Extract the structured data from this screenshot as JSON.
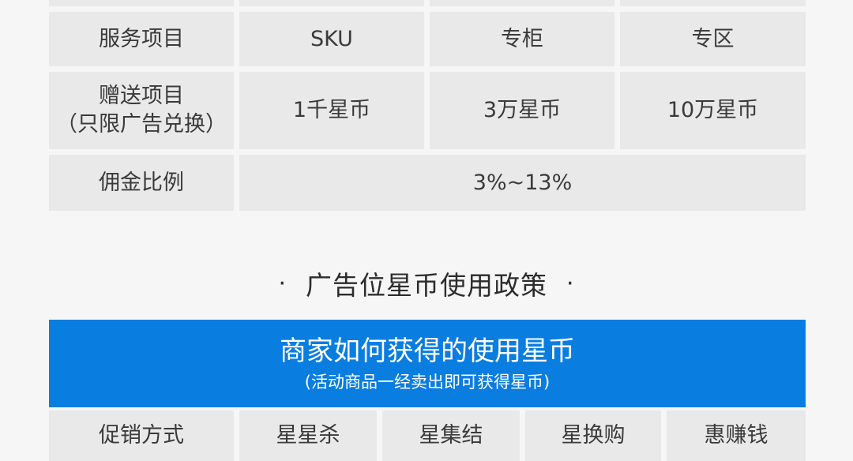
{
  "table1": {
    "rows": [
      {
        "label": "服务项目",
        "cells": [
          "SKU",
          "专柜",
          "专区"
        ]
      },
      {
        "label_lines": [
          "赠送项目",
          "（只限广告兑换）"
        ],
        "cells": [
          "1千星币",
          "3万星币",
          "10万星币"
        ]
      },
      {
        "label": "佣金比例",
        "merged_value": "3%~13%"
      }
    ]
  },
  "section": {
    "title": "广告位星币使用政策",
    "bullet": "·"
  },
  "banner": {
    "title": "商家如何获得的使用星币",
    "subtitle": "(活动商品一经卖出即可获得星币)"
  },
  "table2": {
    "header": [
      "促销方式",
      "星星杀",
      "星集结",
      "星换购",
      "惠赚钱"
    ]
  }
}
